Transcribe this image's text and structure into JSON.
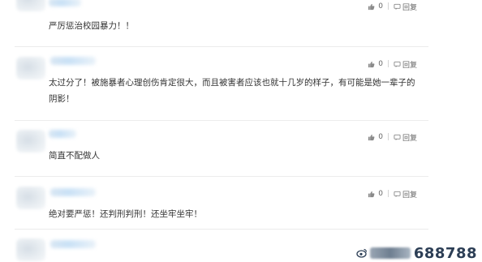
{
  "comments": [
    {
      "likes": "0",
      "reply_label": "回复",
      "text": "严厉惩治校园暴力！！"
    },
    {
      "likes": "0",
      "reply_label": "回复",
      "text": "太过分了！被施暴者心理创伤肯定很大，而且被害者应该也就十几岁的样子，有可能是她一辈子的阴影！"
    },
    {
      "likes": "0",
      "reply_label": "回复",
      "text": "简直不配做人"
    },
    {
      "likes": "0",
      "reply_label": "回复",
      "text": "绝对要严惩！还判刑判刑！还坐牢坐牢！"
    }
  ],
  "watermark": {
    "text": "688788"
  },
  "icons": {
    "like": "thumbs-up-icon",
    "reply": "reply-icon"
  },
  "colors": {
    "text": "#333333",
    "meta": "#666666",
    "divider": "#ececec",
    "watermark": "#2c3e55"
  }
}
